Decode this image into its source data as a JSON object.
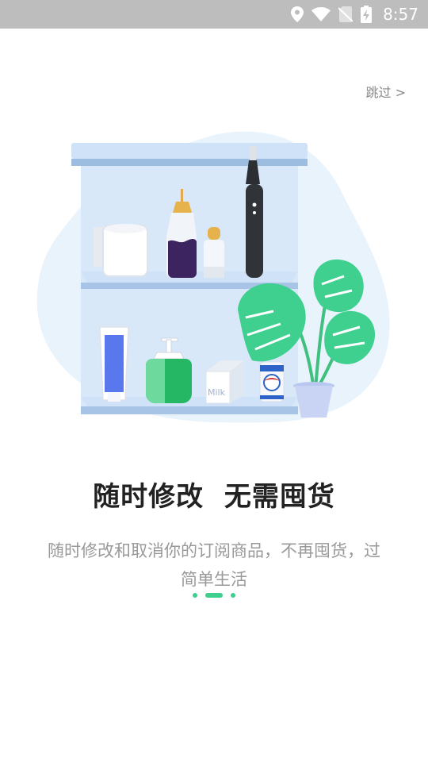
{
  "status_bar": {
    "time": "8:57",
    "icons": [
      "location-icon",
      "wifi-icon",
      "no-sim-icon",
      "battery-charging-icon"
    ]
  },
  "skip": {
    "label": "跳过 >"
  },
  "illustration": {
    "milk_label": "Milk",
    "colors": {
      "shelf": "#cfe2f7",
      "shelf_edge": "#9dbde0",
      "leaf": "#3fd08f",
      "blob": "#e8f3fb"
    }
  },
  "onboarding": {
    "title": "随时修改  无需囤货",
    "description": "随时修改和取消你的订阅商品，不再囤货，过简单生活",
    "current_page": 2,
    "total_pages": 3
  },
  "colors": {
    "accent": "#3ecf8e",
    "status_bar": "#bdbdbd"
  }
}
